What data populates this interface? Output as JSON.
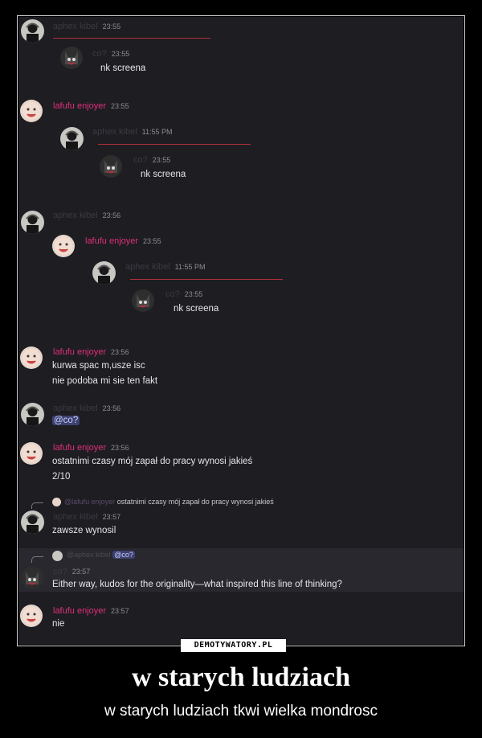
{
  "chat": {
    "m1": {
      "name": "aphex kibel",
      "time": "23:55"
    },
    "m1q": {
      "name": "co?",
      "time": "23:55",
      "text": "nk screena"
    },
    "m2": {
      "name": "lafufu enjoyer",
      "time": "23:55"
    },
    "m2q1": {
      "name": "aphex kibel",
      "time": "11:55 PM"
    },
    "m2q2": {
      "name": "co?",
      "time": "23:55",
      "text": "nk screena"
    },
    "m3": {
      "name": "aphex kibel",
      "time": "23:56"
    },
    "m3q1": {
      "name": "lafufu enjoyer",
      "time": "23:55"
    },
    "m3q2": {
      "name": "aphex kibel",
      "time": "11:55 PM"
    },
    "m3q3": {
      "name": "co?",
      "time": "23:55",
      "text": "nk screena"
    },
    "m4": {
      "name": "lafufu enjoyer",
      "time": "23:56",
      "line1": "kurwa spac m,usze isc",
      "line2": "nie podoba mi sie ten fakt"
    },
    "m5": {
      "name": "aphex kibel",
      "time": "23:56",
      "text": "@co?"
    },
    "m6": {
      "name": "lafufu enjoyer",
      "time": "23:56",
      "line1": "ostatnimi czasy mój zapał do pracy wynosi jakieś",
      "line2": "2/10"
    },
    "m7": {
      "reply_name": "@lafufu enjoyer",
      "reply_text": "ostatnimi czasy mój zapał do pracy wynosi jakieś",
      "name": "aphex kibel",
      "time": "23:57",
      "text": "zawsze wynosil"
    },
    "m8": {
      "reply_name": "@aphex kibel",
      "reply_text": "@co?",
      "name": "co?",
      "time": "23:57",
      "text": "Either way, kudos for the originality—what inspired this line of thinking?"
    },
    "m9": {
      "name": "lafufu enjoyer",
      "time": "23:57",
      "text": "nie"
    }
  },
  "watermark": "DEMOTYWATORY.PL",
  "caption": {
    "title": "w starych ludziach",
    "subtitle": "w starych ludziach tkwi wielka mondrosc"
  },
  "colors": {
    "lafufu": "#e0307a",
    "aphex": "#3a3a42",
    "divider": "#b2313c",
    "background": "#1d1d22",
    "mention": "#3c4270"
  },
  "icons": {
    "aphex_avatar": "person-with-headphones-avatar",
    "lafufu_avatar": "smiling-baby-avatar",
    "co_avatar": "cat-creature-avatar"
  }
}
